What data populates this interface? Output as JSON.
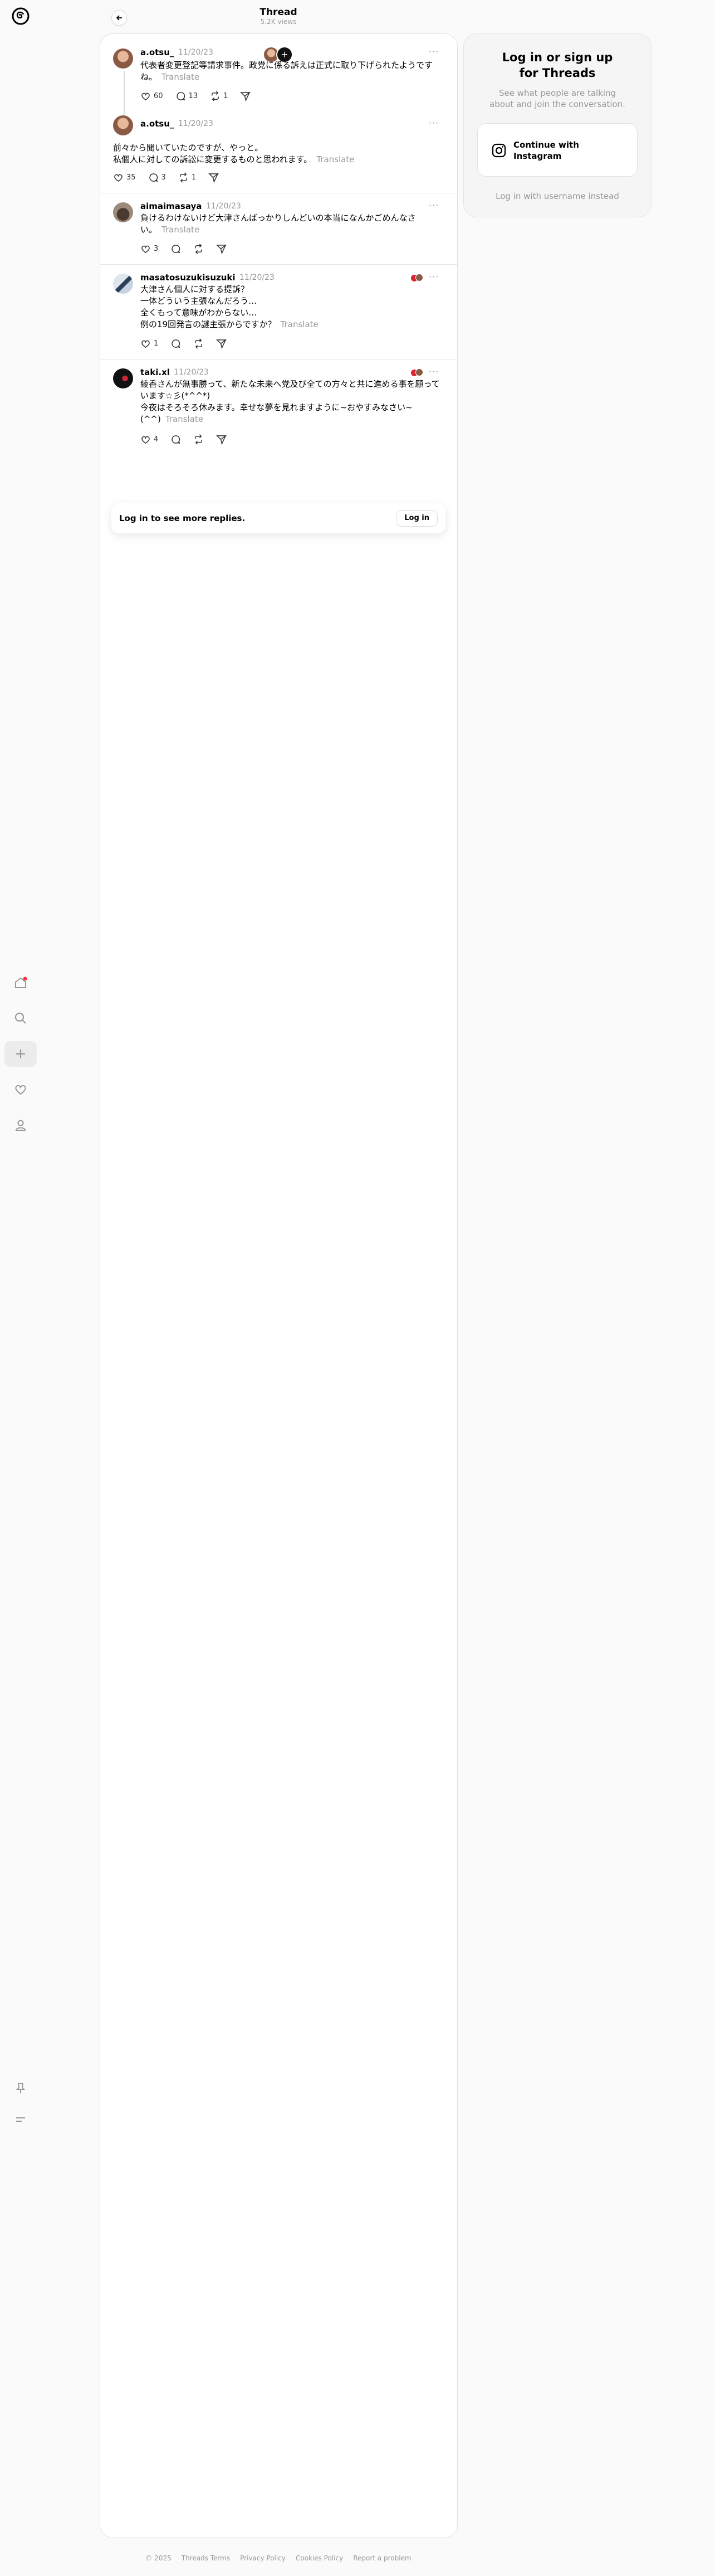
{
  "header": {
    "title": "Thread",
    "views": "5.2K views"
  },
  "nav": {
    "items": [
      "home-icon",
      "search-icon",
      "create-icon",
      "activity-icon",
      "profile-icon"
    ],
    "bottom": [
      "pin-icon",
      "menu-icon"
    ]
  },
  "posts": [
    {
      "username": "a.otsu_",
      "time": "11/20/23",
      "text": "代表者変更登記等請求事件。政党に係る訴えは正式に取り下げられたようです\nね。",
      "translate": "Translate",
      "likes": "60",
      "replies": "13",
      "reposts": "1",
      "shares": ""
    },
    {
      "username": "a.otsu_",
      "time": "11/20/23",
      "text": "前々から聞いていたのですが、やっと。\n私個人に対しての訴訟に変更するものと思われます。",
      "translate": "Translate",
      "likes": "35",
      "replies": "3",
      "reposts": "1",
      "shares": ""
    },
    {
      "username": "aimaimasaya",
      "time": "11/20/23",
      "text": "負けるわけないけど大津さんばっかりしんどいの本当になんかごめんなさ\nい。",
      "translate": "Translate",
      "likes": "3",
      "replies": "",
      "reposts": "",
      "shares": ""
    },
    {
      "username": "masatosuzukisuzuki",
      "time": "11/20/23",
      "text": "大津さん個人に対する提訴？\n一体どういう主張なんだろう…\n全くもって意味がわからない…\n例の19回発言の謎主張からですか？",
      "translate": "Translate",
      "likes": "1",
      "replies": "",
      "reposts": "",
      "shares": ""
    },
    {
      "username": "taki.xl",
      "time": "11/20/23",
      "text": "綾香さんが無事勝って、新たな未来へ党及び全ての方々と共に進める事を願って\nいます☆彡(*^^*)\n今夜はそろそろ休みます。幸せな夢を見れますように~おやすみなさい~\n(^^)",
      "translate": "Translate",
      "likes": "4",
      "replies": "",
      "reposts": "",
      "shares": ""
    }
  ],
  "login_bar": {
    "text": "Log in to see more replies.",
    "button": "Log in"
  },
  "side_panel": {
    "title": "Log in or sign up\nfor Threads",
    "description": "See what people are talking about and join the conversation.",
    "instagram_button": "Continue with Instagram",
    "alt_login": "Log in with username instead"
  },
  "footer": [
    "© 2025",
    "Threads Terms",
    "Privacy Policy",
    "Cookies Policy",
    "Report a problem"
  ]
}
